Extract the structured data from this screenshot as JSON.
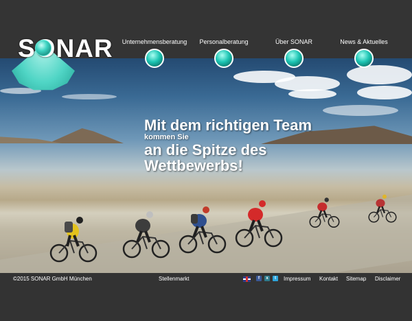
{
  "brand": {
    "name": "SONAR"
  },
  "nav": {
    "items": [
      {
        "label": "Unternehmensberatung"
      },
      {
        "label": "Personalberatung"
      },
      {
        "label": "Über SONAR"
      },
      {
        "label": "News & Aktuelles"
      }
    ]
  },
  "hero": {
    "line1": "Mit dem richtigen Team",
    "line2": "kommen Sie",
    "line3": "an die Spitze des",
    "line4": "Wettbewerbs!"
  },
  "footer": {
    "copyright": "©2015 SONAR GmbH München",
    "stellenmarkt": "Stellenmarkt",
    "impressum": "Impressum",
    "kontakt": "Kontakt",
    "sitemap": "Sitemap",
    "disclaimer": "Disclaimer",
    "language_icon": "uk-flag-icon",
    "social_icons": [
      "facebook-icon",
      "xing-icon",
      "twitter-icon"
    ]
  },
  "colors": {
    "background": "#333333",
    "accent": "#3dd3c1",
    "text": "#ffffff"
  }
}
